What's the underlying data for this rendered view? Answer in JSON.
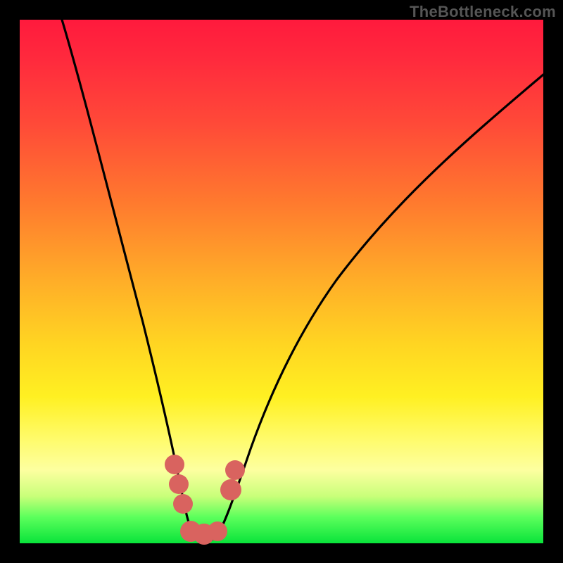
{
  "watermark": "TheBottleneck.com",
  "colors": {
    "frame": "#000000",
    "gradient_top": "#ff1a3d",
    "gradient_mid1": "#ff7a2e",
    "gradient_mid2": "#ffd522",
    "gradient_mid3": "#fdffa0",
    "gradient_bottom": "#09e33a",
    "curve_stroke": "#000000",
    "marker_fill": "#d9635f",
    "watermark_color": "#555555"
  },
  "chart_data": {
    "type": "line",
    "title": "",
    "xlabel": "",
    "ylabel": "",
    "xlim": [
      0,
      100
    ],
    "ylim": [
      0,
      100
    ],
    "series": [
      {
        "name": "curve",
        "x": [
          8,
          12,
          16,
          20,
          24,
          26,
          28,
          30,
          31,
          32,
          33,
          34,
          35,
          36,
          38,
          40,
          44,
          48,
          52,
          56,
          62,
          68,
          74,
          80,
          86,
          92,
          100
        ],
        "y": [
          100,
          87,
          73,
          58,
          42,
          33,
          24,
          15,
          10,
          6,
          3,
          1,
          1,
          1,
          3,
          6,
          14,
          22,
          30,
          37,
          47,
          55,
          62,
          68,
          73,
          78,
          84
        ]
      }
    ],
    "markers": {
      "name": "highlighted-points",
      "x": [
        29,
        30.5,
        33,
        35,
        36.5,
        38.5,
        40
      ],
      "y": [
        17,
        10,
        2,
        2,
        3,
        7,
        11
      ],
      "r": 2.6
    },
    "notes": "No axes, ticks, or numeric labels are visible. Gradient background runs red (top) to green (bottom). A single black V-shaped curve dips to the floor around x≈34. A small cluster of salmon-colored round markers sits along the bottom of the V."
  }
}
